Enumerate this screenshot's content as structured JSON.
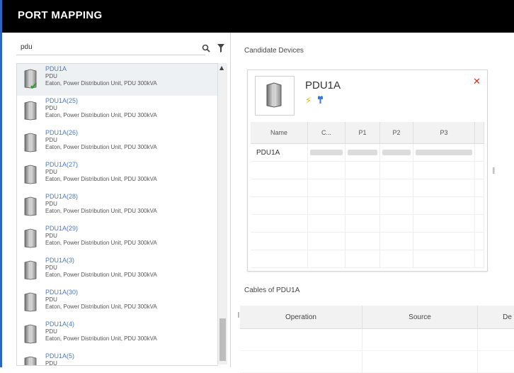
{
  "app": {
    "title": "PORT MAPPING"
  },
  "search": {
    "value": "pdu",
    "placeholder": ""
  },
  "devices": [
    {
      "name": "PDU1A",
      "type": "PDU",
      "desc": "Eaton, Power Distribution Unit, PDU 300kVA",
      "selected": true
    },
    {
      "name": "PDU1A(25)",
      "type": "PDU",
      "desc": "Eaton, Power Distribution Unit, PDU 300kVA",
      "selected": false
    },
    {
      "name": "PDU1A(26)",
      "type": "PDU",
      "desc": "Eaton, Power Distribution Unit, PDU 300kVA",
      "selected": false
    },
    {
      "name": "PDU1A(27)",
      "type": "PDU",
      "desc": "Eaton, Power Distribution Unit, PDU 300kVA",
      "selected": false
    },
    {
      "name": "PDU1A(28)",
      "type": "PDU",
      "desc": "Eaton, Power Distribution Unit, PDU 300kVA",
      "selected": false
    },
    {
      "name": "PDU1A(29)",
      "type": "PDU",
      "desc": "Eaton, Power Distribution Unit, PDU 300kVA",
      "selected": false
    },
    {
      "name": "PDU1A(3)",
      "type": "PDU",
      "desc": "Eaton, Power Distribution Unit, PDU 300kVA",
      "selected": false
    },
    {
      "name": "PDU1A(30)",
      "type": "PDU",
      "desc": "Eaton, Power Distribution Unit, PDU 300kVA",
      "selected": false
    },
    {
      "name": "PDU1A(4)",
      "type": "PDU",
      "desc": "Eaton, Power Distribution Unit, PDU 300kVA",
      "selected": false
    },
    {
      "name": "PDU1A(5)",
      "type": "PDU",
      "desc": "",
      "selected": false
    }
  ],
  "candidate": {
    "label": "Candidate Devices",
    "card": {
      "name": "PDU1A",
      "columns": [
        "Name",
        "C...",
        "P1",
        "P2",
        "P3"
      ],
      "rows": [
        {
          "name": "PDU1A"
        }
      ]
    }
  },
  "cables": {
    "label": "Cables of PDU1A",
    "columns": [
      "Operation",
      "Source",
      "De"
    ]
  },
  "icons": {
    "search": "search-icon",
    "filter": "filter-icon",
    "device": "pdu-device-icon",
    "check": "check-icon",
    "power": "power-bolt-icon",
    "plug": "plug-icon",
    "close": "close-icon"
  },
  "colors": {
    "titlebar": "#000000",
    "accent": "#2a66c5",
    "link": "#4a7ab8",
    "check": "#2e9b2e",
    "close": "#d9302a",
    "bolt": "#f0b400"
  }
}
